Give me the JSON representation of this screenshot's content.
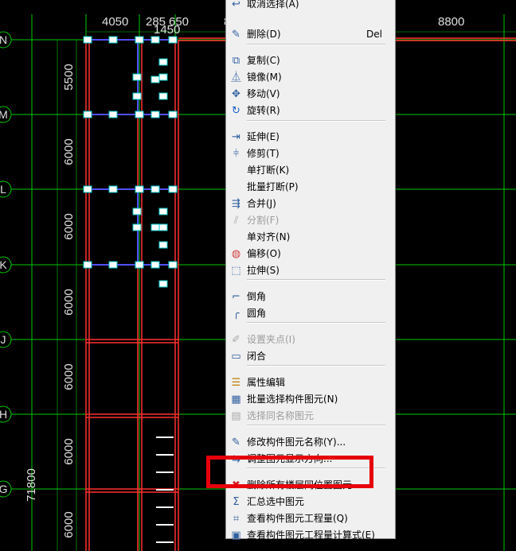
{
  "canvas": {
    "top_dims": [
      "4050",
      "285",
      "650",
      "1450",
      "8",
      "8800"
    ],
    "axes": [
      "N",
      "M",
      "L",
      "K",
      "J",
      "H",
      "G"
    ],
    "left_dims": [
      "5500",
      "6000",
      "6000",
      "6000",
      "6000",
      "6000",
      "6000"
    ],
    "total_dim": "71800"
  },
  "menu": {
    "items": [
      {
        "label": "取消选择(A)",
        "icon": "deselect-icon",
        "disabled": false
      },
      {
        "label": "删除(D)",
        "shortcut": "Del",
        "icon": "eraser-icon",
        "disabled": false
      },
      {
        "label": "复制(C)",
        "icon": "copy-icon",
        "disabled": false
      },
      {
        "label": "镜像(M)",
        "icon": "mirror-icon",
        "disabled": false
      },
      {
        "label": "移动(V)",
        "icon": "move-icon",
        "disabled": false
      },
      {
        "label": "旋转(R)",
        "icon": "rotate-icon",
        "disabled": false
      },
      {
        "label": "延伸(E)",
        "icon": "extend-icon",
        "disabled": false
      },
      {
        "label": "修剪(T)",
        "icon": "trim-icon",
        "disabled": false
      },
      {
        "label": "单打断(K)",
        "icon": "",
        "disabled": false
      },
      {
        "label": "批量打断(P)",
        "icon": "",
        "disabled": false
      },
      {
        "label": "合并(J)",
        "icon": "merge-icon",
        "disabled": false
      },
      {
        "label": "分割(F)",
        "icon": "split-icon",
        "disabled": true
      },
      {
        "label": "单对齐(N)",
        "icon": "",
        "disabled": false
      },
      {
        "label": "偏移(O)",
        "icon": "offset-icon",
        "disabled": false
      },
      {
        "label": "拉伸(S)",
        "icon": "stretch-icon",
        "disabled": false
      },
      {
        "label": "倒角",
        "icon": "chamfer-icon",
        "disabled": false
      },
      {
        "label": "圆角",
        "icon": "fillet-icon",
        "disabled": false
      },
      {
        "label": "设置夹点(I)",
        "icon": "grip-icon",
        "disabled": true
      },
      {
        "label": "闭合",
        "icon": "close-shape-icon",
        "disabled": false
      },
      {
        "label": "属性编辑",
        "icon": "property-edit-icon",
        "disabled": false
      },
      {
        "label": "批量选择构件图元(N)",
        "icon": "batch-select-icon",
        "disabled": false
      },
      {
        "label": "选择同名称图元",
        "icon": "same-name-select-icon",
        "disabled": true
      },
      {
        "label": "修改构件图元名称(Y)...",
        "icon": "rename-icon",
        "disabled": false
      },
      {
        "label": "调整图元显示方向...",
        "icon": "display-direction-icon",
        "disabled": false
      },
      {
        "label": "删除所有楼层同位置图元",
        "icon": "delete-all-floors-icon",
        "disabled": false
      },
      {
        "label": "汇总选中图元",
        "icon": "summary-icon",
        "disabled": false
      },
      {
        "label": "查看构件图元工程量(Q)",
        "icon": "quantity-icon",
        "disabled": false
      },
      {
        "label": "查看构件图元工程量计算式(E)",
        "icon": "formula-icon",
        "disabled": false
      }
    ]
  },
  "colors": {
    "highlight": "#e6000a",
    "grid": "#00c800",
    "wall": "#ff3030",
    "beam": "#5050ff"
  }
}
